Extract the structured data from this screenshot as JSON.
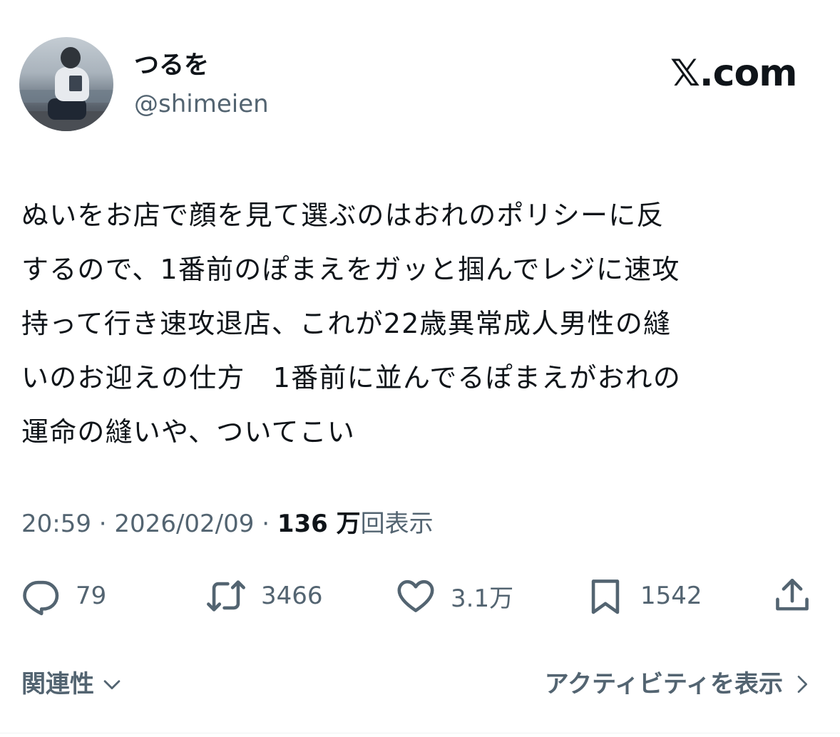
{
  "author": {
    "name": "つるを",
    "handle": "@shimeien"
  },
  "brand": "𝕏.com",
  "tweet": {
    "lines": [
      "ぬいをお店で顔を見て選ぶのはおれのポリシーに反",
      "するので、1番前のぽまえをガッと掴んでレジに速攻",
      "持って行き速攻退店、これが22歳異常成人男性の縫",
      "いのお迎えの仕方　1番前に並んでるぽまえがおれの",
      "運命の縫いや、ついてこい"
    ]
  },
  "meta": {
    "time": "20:59",
    "sep1": " · ",
    "date": "2026/02/09",
    "sep2": " · ",
    "views_count": "136 万",
    "views_label": "回表示"
  },
  "actions": {
    "replies": "79",
    "reposts": "3466",
    "likes": "3.1万",
    "bookmarks": "1542"
  },
  "footer": {
    "relevance": "関連性",
    "activity": "アクティビティを表示"
  },
  "icons": [
    "reply-icon",
    "repost-icon",
    "like-icon",
    "bookmark-icon",
    "share-icon",
    "chevron-down-icon",
    "chevron-right-icon"
  ]
}
